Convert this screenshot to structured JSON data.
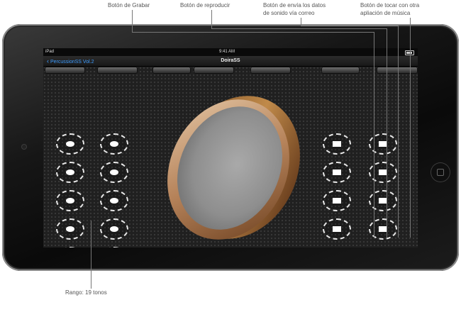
{
  "annotations": {
    "record": "Botón de Grabar",
    "play": "Botón de reproducir",
    "mail_line1": "Botón de envía los datos",
    "mail_line2": "de sonido vía correo",
    "music_line1": "Botón de tocar con otra",
    "music_line2": "apliación de música",
    "range": "Rango: 19 tonos"
  },
  "statusbar": {
    "carrier": "iPad",
    "time": "9:41 AM"
  },
  "navbar": {
    "back_label": "PercussionSS Vol.2",
    "title": "DoiraSS"
  },
  "pads": {
    "left_count": 10,
    "right_count": 8
  },
  "toolbar": {
    "record_icon": "record-icon",
    "play_icon": "play-icon",
    "mail_icon": "mail-icon",
    "music_icon": "music-note-icon",
    "music_glyph": "♫",
    "record_color": "#e02020"
  }
}
